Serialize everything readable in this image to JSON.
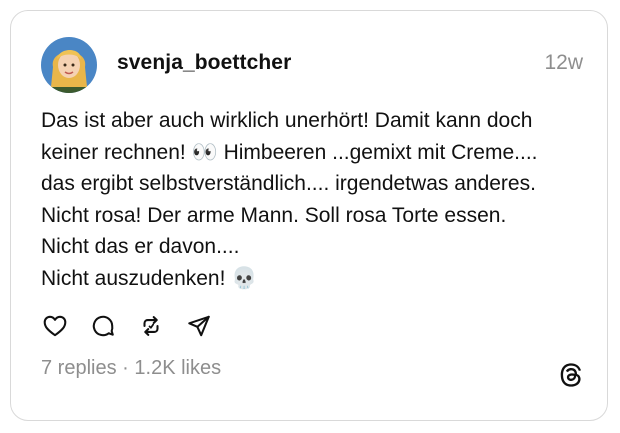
{
  "post": {
    "username": "svenja_boettcher",
    "time": "12w",
    "text": "Das ist aber auch wirklich unerhört! Damit kann doch\nkeiner rechnen! 👀 Himbeeren ...gemixt mit Creme....\ndas ergibt selbstverständlich.... irgendetwas anderes.\nNicht rosa! Der arme Mann. Soll rosa Torte essen.\nNicht das er davon....\nNicht auszudenken! 💀",
    "replies": "7 replies",
    "separator": " · ",
    "likes": "1.2K likes"
  },
  "icons": {
    "like": "heart-icon",
    "reply": "comment-icon",
    "repost": "repost-icon",
    "share": "send-icon",
    "brand": "threads-logo-icon"
  },
  "colors": {
    "text": "#111111",
    "muted": "#8e8e8e",
    "border": "#d9d9d9"
  }
}
